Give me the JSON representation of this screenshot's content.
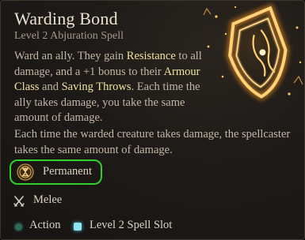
{
  "spell": {
    "name": "Warding Bond",
    "subtitle": "Level 2 Abjuration Spell",
    "description": {
      "p1_a": "Ward an ally. They gain ",
      "kw_resistance": "Resistance",
      "p1_b": " to all damage, and a +1 bonus to their ",
      "kw_armour_class": "Armour Class",
      "p1_c": " and ",
      "kw_saving_throws": "Saving Throws",
      "p1_d": ". Each time the ally takes damage, you take the same amount of damage.",
      "p2": "Each time the warded creature takes damage, the spellcaster takes the same amount of damage."
    },
    "duration": {
      "label": "Permanent",
      "icon": "hourglass-icon"
    },
    "range": {
      "label": "Melee",
      "icon": "crossed-swords-icon"
    },
    "costs": [
      {
        "label": "Action",
        "icon": "action-dot-icon",
        "color": "#2c6b57"
      },
      {
        "label": "Level 2 Spell Slot",
        "icon": "spell-slot-icon",
        "color": "#8fe4f2"
      }
    ],
    "art_icon": "glowing-shield-icon",
    "colors": {
      "keyword": "#efe39e",
      "highlight_outline": "#2fd12a",
      "art_glow": "#ffb43c"
    }
  }
}
